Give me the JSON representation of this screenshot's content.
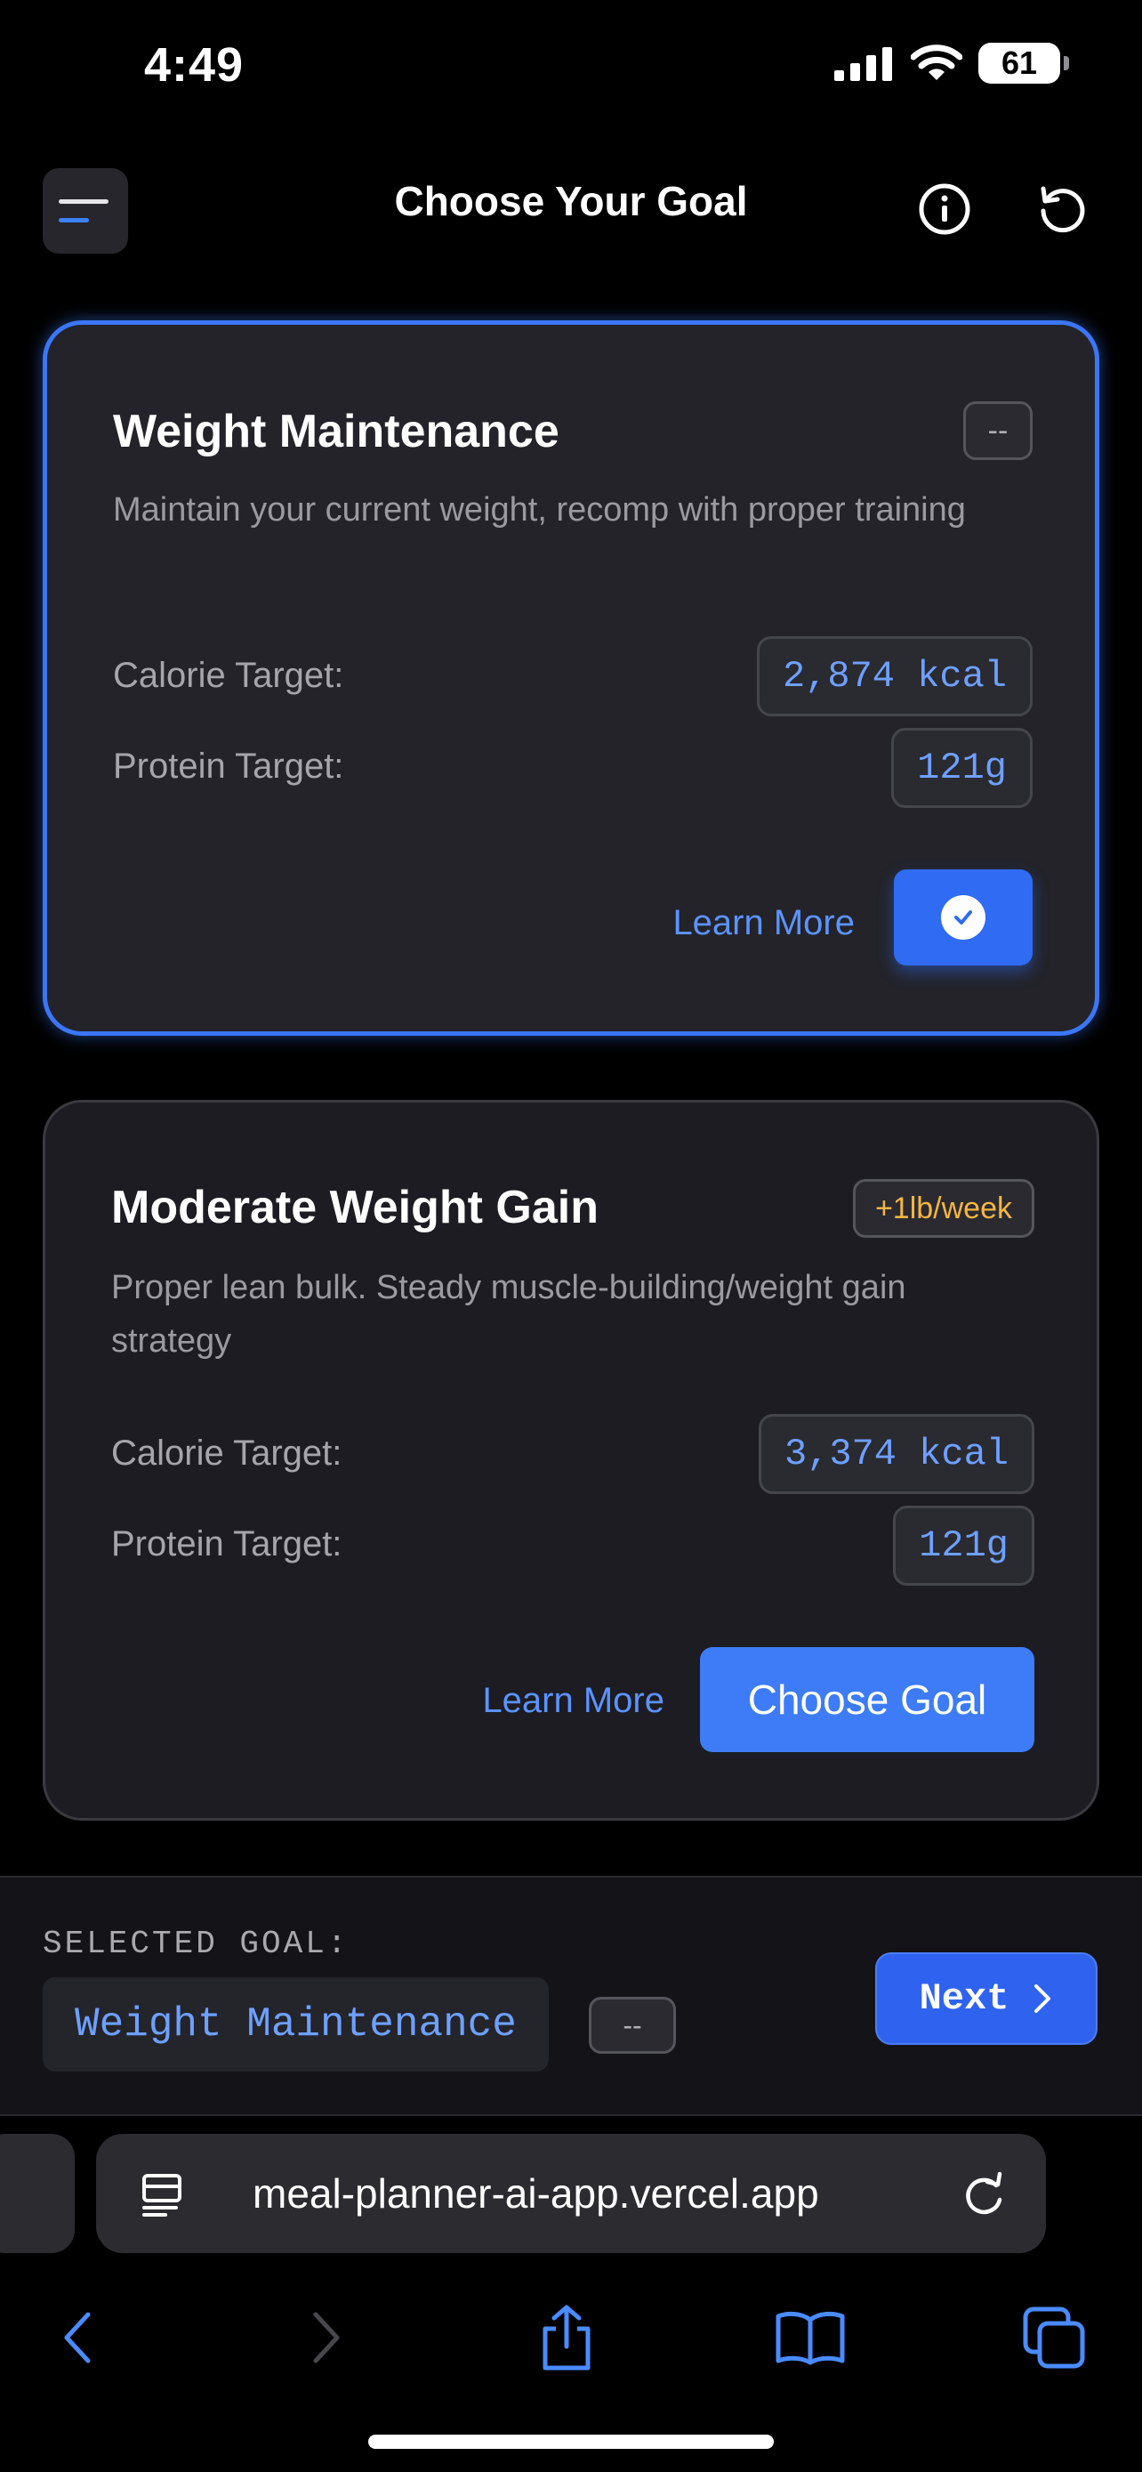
{
  "status_bar": {
    "time": "4:49",
    "battery": "61"
  },
  "header": {
    "title": "Choose Your Goal"
  },
  "cards": [
    {
      "title": "Weight Maintenance",
      "rate": "--",
      "description": "Maintain your current weight, recomp with proper training",
      "calorie_label": "Calorie Target:",
      "calorie_value": "2,874 kcal",
      "protein_label": "Protein Target:",
      "protein_value": "121g",
      "learn_more": "Learn More",
      "selected": true
    },
    {
      "title": "Moderate Weight Gain",
      "rate": "+1lb/week",
      "description": "Proper lean bulk. Steady muscle-building/weight gain strategy",
      "calorie_label": "Calorie Target:",
      "calorie_value": "3,374 kcal",
      "protein_label": "Protein Target:",
      "protein_value": "121g",
      "learn_more": "Learn More",
      "action_label": "Choose Goal",
      "selected": false
    }
  ],
  "selected_goal": {
    "caption": "SELECTED GOAL:",
    "name": "Weight Maintenance",
    "rate": "--",
    "next_label": "Next"
  },
  "browser": {
    "url": "meal-planner-ai-app.vercel.app"
  },
  "colors": {
    "accent": "#3b76f6",
    "link": "#5c93ff",
    "rate_gain": "#f5b642",
    "background": "#000000"
  },
  "icons": [
    "menu-icon",
    "info-icon",
    "reset-icon",
    "check-icon",
    "chevron-right-icon",
    "reader-icon",
    "reload-icon",
    "back-icon",
    "forward-icon",
    "share-icon",
    "bookmarks-icon",
    "tabs-icon"
  ]
}
